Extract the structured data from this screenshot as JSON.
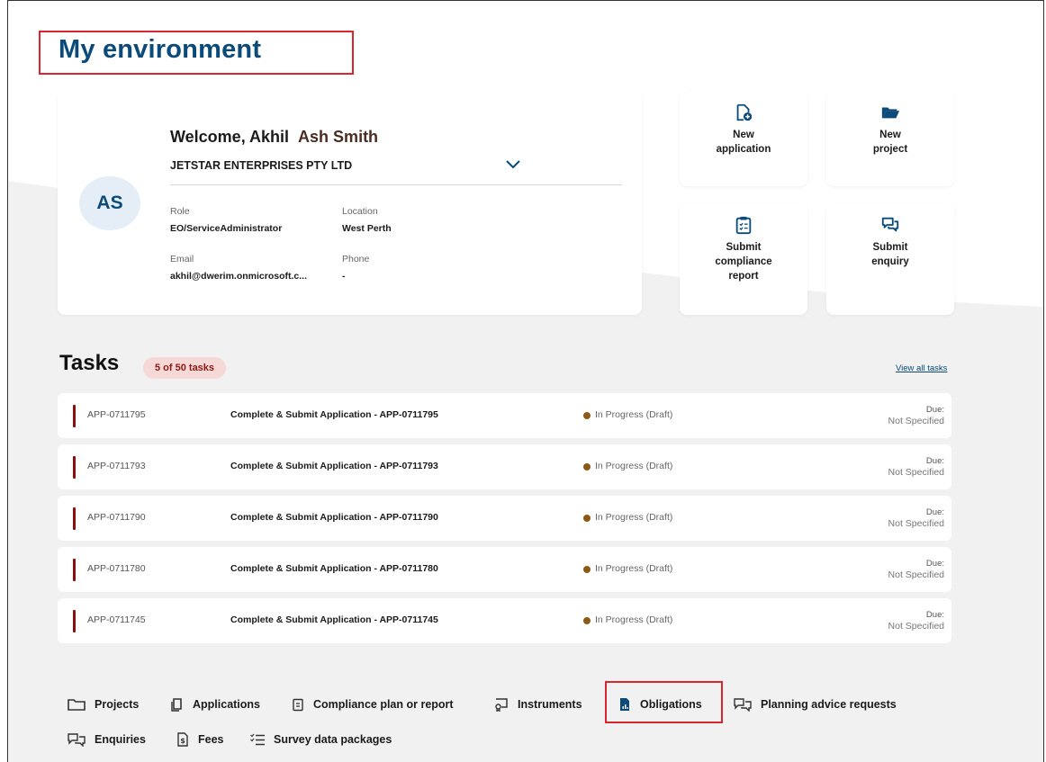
{
  "page": {
    "title": "My environment"
  },
  "profile": {
    "initials": "AS",
    "welcome": "Welcome, Akhil",
    "name": "Ash Smith",
    "company": "JETSTAR ENTERPRISES PTY LTD",
    "fields": {
      "role_label": "Role",
      "role": "EO/ServiceAdministrator",
      "location_label": "Location",
      "location": "West Perth",
      "email_label": "Email",
      "email": "akhil@dwerim.onmicrosoft.c...",
      "phone_label": "Phone",
      "phone": "-"
    }
  },
  "actions": [
    {
      "label_1": "New",
      "label_2": "application",
      "icon": "new-file-icon"
    },
    {
      "label_1": "New",
      "label_2": "project",
      "icon": "folder-open-icon"
    },
    {
      "label_1": "Submit",
      "label_2": "compliance",
      "label_3": "report",
      "icon": "clipboard-icon"
    },
    {
      "label_1": "Submit",
      "label_2": "enquiry",
      "icon": "chat-icon"
    }
  ],
  "tasks": {
    "heading": "Tasks",
    "count_badge": "5 of 50 tasks",
    "view_all": "View all tasks",
    "due_label": "Due:",
    "items": [
      {
        "id": "APP-0711795",
        "title": "Complete & Submit Application - APP-0711795",
        "status": "In Progress (Draft)",
        "due": "Not Specified"
      },
      {
        "id": "APP-0711793",
        "title": "Complete & Submit Application - APP-0711793",
        "status": "In Progress (Draft)",
        "due": "Not Specified"
      },
      {
        "id": "APP-0711790",
        "title": "Complete & Submit Application - APP-0711790",
        "status": "In Progress (Draft)",
        "due": "Not Specified"
      },
      {
        "id": "APP-0711780",
        "title": "Complete & Submit Application - APP-0711780",
        "status": "In Progress (Draft)",
        "due": "Not Specified"
      },
      {
        "id": "APP-0711745",
        "title": "Complete & Submit Application - APP-0711745",
        "status": "In Progress (Draft)",
        "due": "Not Specified"
      }
    ]
  },
  "nav": {
    "projects": "Projects",
    "applications": "Applications",
    "compliance": "Compliance plan or report",
    "instruments": "Instruments",
    "obligations": "Obligations",
    "planning": "Planning advice requests",
    "enquiries": "Enquiries",
    "fees": "Fees",
    "survey": "Survey data packages"
  },
  "colors": {
    "brand": "#0b4a79",
    "task_bar": "#8b0f0f",
    "status_dot": "#8a5a16",
    "highlight": "#d9262e"
  }
}
